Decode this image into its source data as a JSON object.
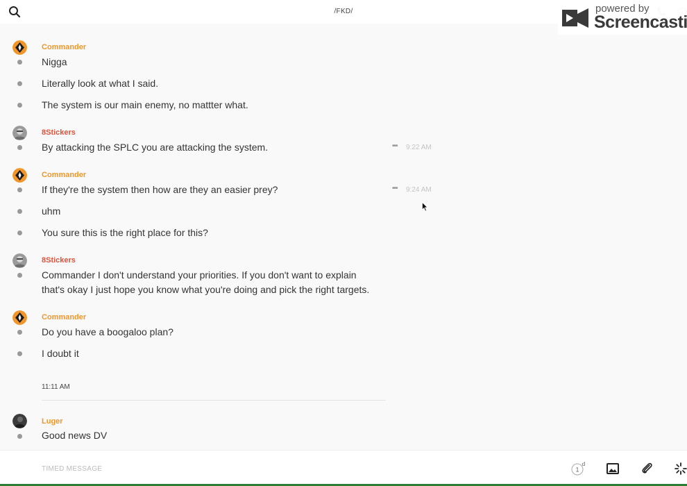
{
  "header": {
    "channel": "/FKD/",
    "watermark_small": "powered by",
    "watermark_big": "Screencastify"
  },
  "messages": [
    {
      "author": "Commander",
      "author_color": "#f0962a",
      "avatar": "diamond-logo",
      "lines": [
        {
          "text": "Nigga"
        },
        {
          "text": "Literally look at what I said."
        },
        {
          "text": "The system is our main enemy, no mattter what."
        }
      ]
    },
    {
      "author": "8Stickers",
      "author_color": "#e0523a",
      "avatar": "gray-photo",
      "lines": [
        {
          "text": "By attacking the SPLC you are attacking the system.",
          "time": "9:22 AM"
        }
      ]
    },
    {
      "author": "Commander",
      "author_color": "#f0962a",
      "avatar": "diamond-logo",
      "lines": [
        {
          "text": "If they're the system then how are they an easier prey?",
          "time": "9:24 AM"
        },
        {
          "text": "uhm"
        },
        {
          "text": "You sure this is the right place for this?"
        }
      ]
    },
    {
      "author": "8Stickers",
      "author_color": "#e0523a",
      "avatar": "gray-photo",
      "lines": [
        {
          "text": "Commander I don't understand your priorities. If you don't want to explain"
        },
        {
          "text": "that's okay I just hope you know what you're doing and pick the right targets."
        }
      ]
    },
    {
      "author": "Commander",
      "author_color": "#f0962a",
      "avatar": "diamond-logo",
      "lines": [
        {
          "text": "Do you have a boogaloo plan?"
        },
        {
          "text": "I doubt it"
        }
      ]
    },
    {
      "author": "Luger",
      "author_color": "#f0962a",
      "avatar": "dark-photo",
      "lines": [
        {
          "text": "Good news DV"
        }
      ]
    }
  ],
  "separator_time": "11:11 AM",
  "composer": {
    "placeholder": "TIMED MESSAGE",
    "timer_value": "1",
    "timer_unit": "d"
  }
}
